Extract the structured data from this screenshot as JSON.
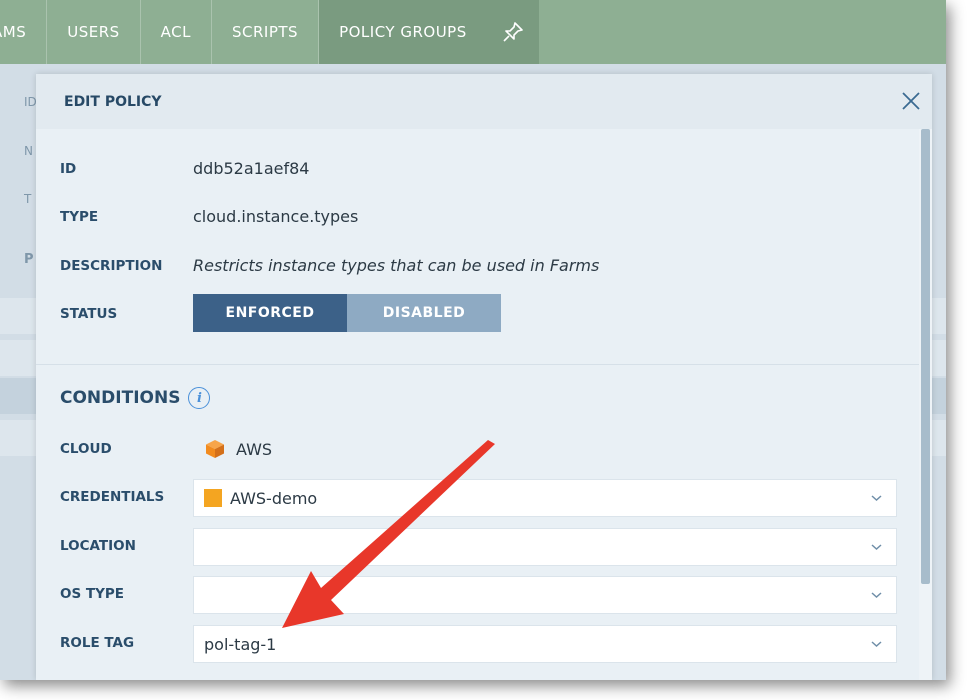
{
  "topnav": {
    "tabs": [
      {
        "label": "AMS"
      },
      {
        "label": "USERS"
      },
      {
        "label": "ACL"
      },
      {
        "label": "SCRIPTS"
      },
      {
        "label": "POLICY GROUPS"
      }
    ],
    "pin_icon": "pin-icon"
  },
  "background": {
    "letters": [
      "ID",
      "N",
      "T",
      "P"
    ]
  },
  "dialog": {
    "title": "EDIT POLICY",
    "close_icon": "close-icon",
    "fields": {
      "id_label": "ID",
      "id_value": "ddb52a1aef84",
      "type_label": "TYPE",
      "type_value": "cloud.instance.types",
      "description_label": "DESCRIPTION",
      "description_value": "Restricts instance types that can be used in Farms",
      "status_label": "STATUS",
      "status_options": [
        "ENFORCED",
        "DISABLED"
      ],
      "status_selected": "ENFORCED"
    },
    "conditions": {
      "heading": "CONDITIONS",
      "info_icon": "info-icon",
      "cloud_label": "CLOUD",
      "cloud_value": "AWS",
      "cloud_icon": "aws-cube-icon",
      "credentials_label": "CREDENTIALS",
      "credentials_value": "AWS-demo",
      "location_label": "LOCATION",
      "location_value": "",
      "os_type_label": "OS TYPE",
      "os_type_value": "",
      "role_tag_label": "ROLE TAG",
      "role_tag_value": "pol-tag-1"
    }
  },
  "colors": {
    "nav_bg": "#8eaf93",
    "nav_active": "#7a9b80",
    "label_text": "#2a4d6b",
    "enforced_bg": "#3c6188",
    "disabled_bg": "#8eaac3",
    "annotation_arrow": "#e8372a",
    "aws_orange": "#f28b1e"
  }
}
